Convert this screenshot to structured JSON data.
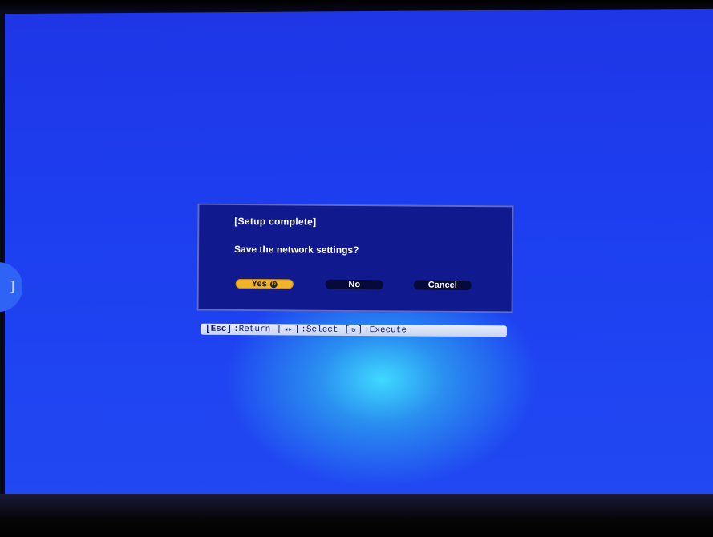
{
  "dialog": {
    "title": "[Setup complete]",
    "prompt": "Save the network settings?",
    "buttons": {
      "yes": {
        "label": "Yes",
        "selected": true,
        "icon": "enter-icon"
      },
      "no": {
        "label": "No"
      },
      "cancel": {
        "label": "Cancel"
      }
    }
  },
  "help_bar": {
    "esc_key": "[Esc]",
    "esc_action": ":Return",
    "select_key_open": "[",
    "select_key_close": "]",
    "select_action": ":Select",
    "execute_key_open": "[",
    "execute_key_close": "]",
    "execute_action": ":Execute"
  },
  "edge_tab": {
    "glyph": "]"
  },
  "colors": {
    "screen_blue": "#1e36e6",
    "dialog_bg": "#101a8e",
    "yes_highlight": "#f2b42a",
    "help_bar_bg": "#d8e0f8"
  }
}
